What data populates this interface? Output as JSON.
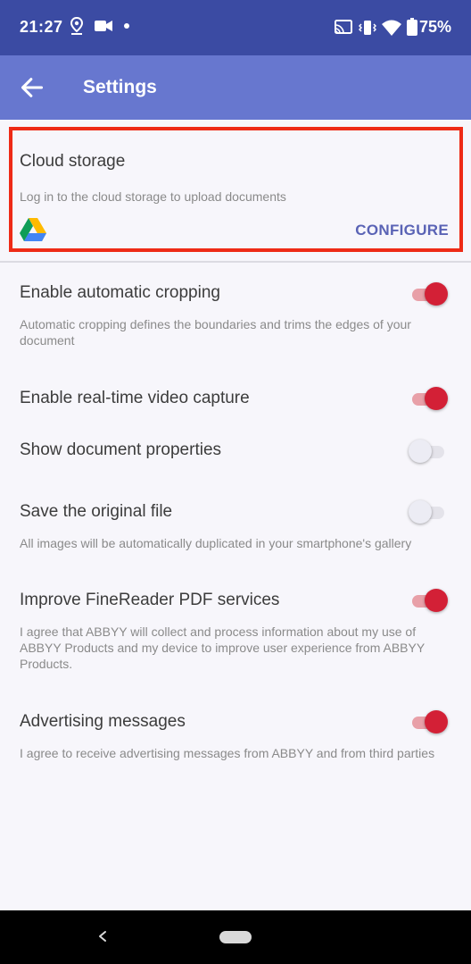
{
  "status_bar": {
    "time": "21:27",
    "battery": "75%",
    "icons": [
      "location-icon",
      "video-icon",
      "dot-icon",
      "cast-icon",
      "vibrate-icon",
      "wifi-icon",
      "battery-icon"
    ]
  },
  "app_bar": {
    "title": "Settings",
    "back_icon": "arrow-left-icon"
  },
  "cloud_storage": {
    "title": "Cloud storage",
    "subtitle": "Log in to the cloud storage to upload documents",
    "provider_icon": "google-drive-icon",
    "action_label": "CONFIGURE",
    "highlight_color": "#ee2a16"
  },
  "settings": [
    {
      "title": "Enable automatic cropping",
      "subtitle": "Automatic cropping defines the boundaries and trims the edges of your document",
      "enabled": true
    },
    {
      "title": "Enable real-time video capture",
      "subtitle": "",
      "enabled": true
    },
    {
      "title": "Show document properties",
      "subtitle": "",
      "enabled": false
    },
    {
      "title": "Save the original file",
      "subtitle": "All images will be automatically duplicated in your smartphone's gallery",
      "enabled": false
    },
    {
      "title": "Improve FineReader PDF services",
      "subtitle": "I agree that ABBYY will collect and process information about my use of ABBYY Products and my device to improve user experience from ABBYY Products.",
      "enabled": true
    },
    {
      "title": "Advertising messages",
      "subtitle": "I agree to receive advertising messages from ABBYY and from third parties",
      "enabled": true
    }
  ],
  "colors": {
    "status_bar": "#3b4ba3",
    "app_bar": "#6777cf",
    "accent": "#5a63b5",
    "switch_on": "#d32036"
  }
}
